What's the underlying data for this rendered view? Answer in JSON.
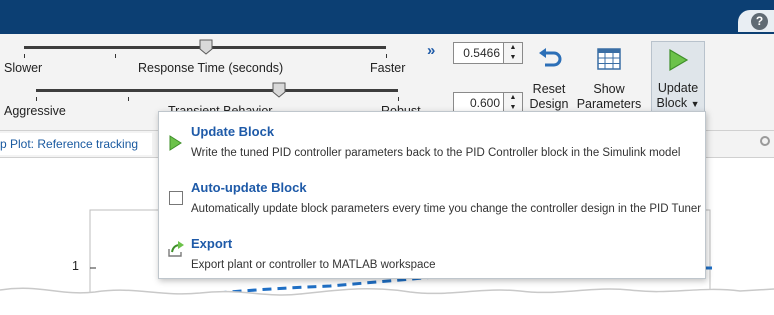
{
  "titlebar": {
    "help_icon": "question-mark-icon",
    "help_label": "?"
  },
  "toolstrip": {
    "response_slider": {
      "left_label": "Slower",
      "center_label": "Response Time (seconds)",
      "right_label": "Faster"
    },
    "transient_slider": {
      "left_label": "Aggressive",
      "center_label": "Transient Behavior",
      "right_label": "Robust"
    },
    "expand_icon": "double-chevron-right-icon",
    "response_value": "0.5466",
    "transient_value": "0.600",
    "reset_design": {
      "line1": "Reset",
      "line2": "Design",
      "icon": "undo-arrow-icon"
    },
    "show_parameters": {
      "line1": "Show",
      "line2": "Parameters",
      "icon": "table-icon"
    },
    "update_block": {
      "line1": "Update",
      "line2": "Block",
      "icon": "play-triangle-icon"
    }
  },
  "plot_tab": {
    "label": "p Plot: Reference tracking"
  },
  "plot": {
    "ytick_1": "1"
  },
  "menu": {
    "items": [
      {
        "title": "Update  Block",
        "description": "Write the tuned PID controller parameters back to the PID Controller block in the Simulink model",
        "icon": "play-triangle-icon"
      },
      {
        "title": "Auto-update Block",
        "description": "Automatically update block parameters every time you change the controller design in the PID Tuner",
        "icon": "checkbox-icon"
      },
      {
        "title": "Export",
        "description": "Export plant or controller to MATLAB workspace",
        "icon": "export-arrow-icon"
      }
    ]
  },
  "colors": {
    "titlebar": "#0c3f73",
    "accent_blue": "#1e5aa8",
    "play_green": "#6cc24a",
    "plot_line": "#1f6fc5"
  }
}
